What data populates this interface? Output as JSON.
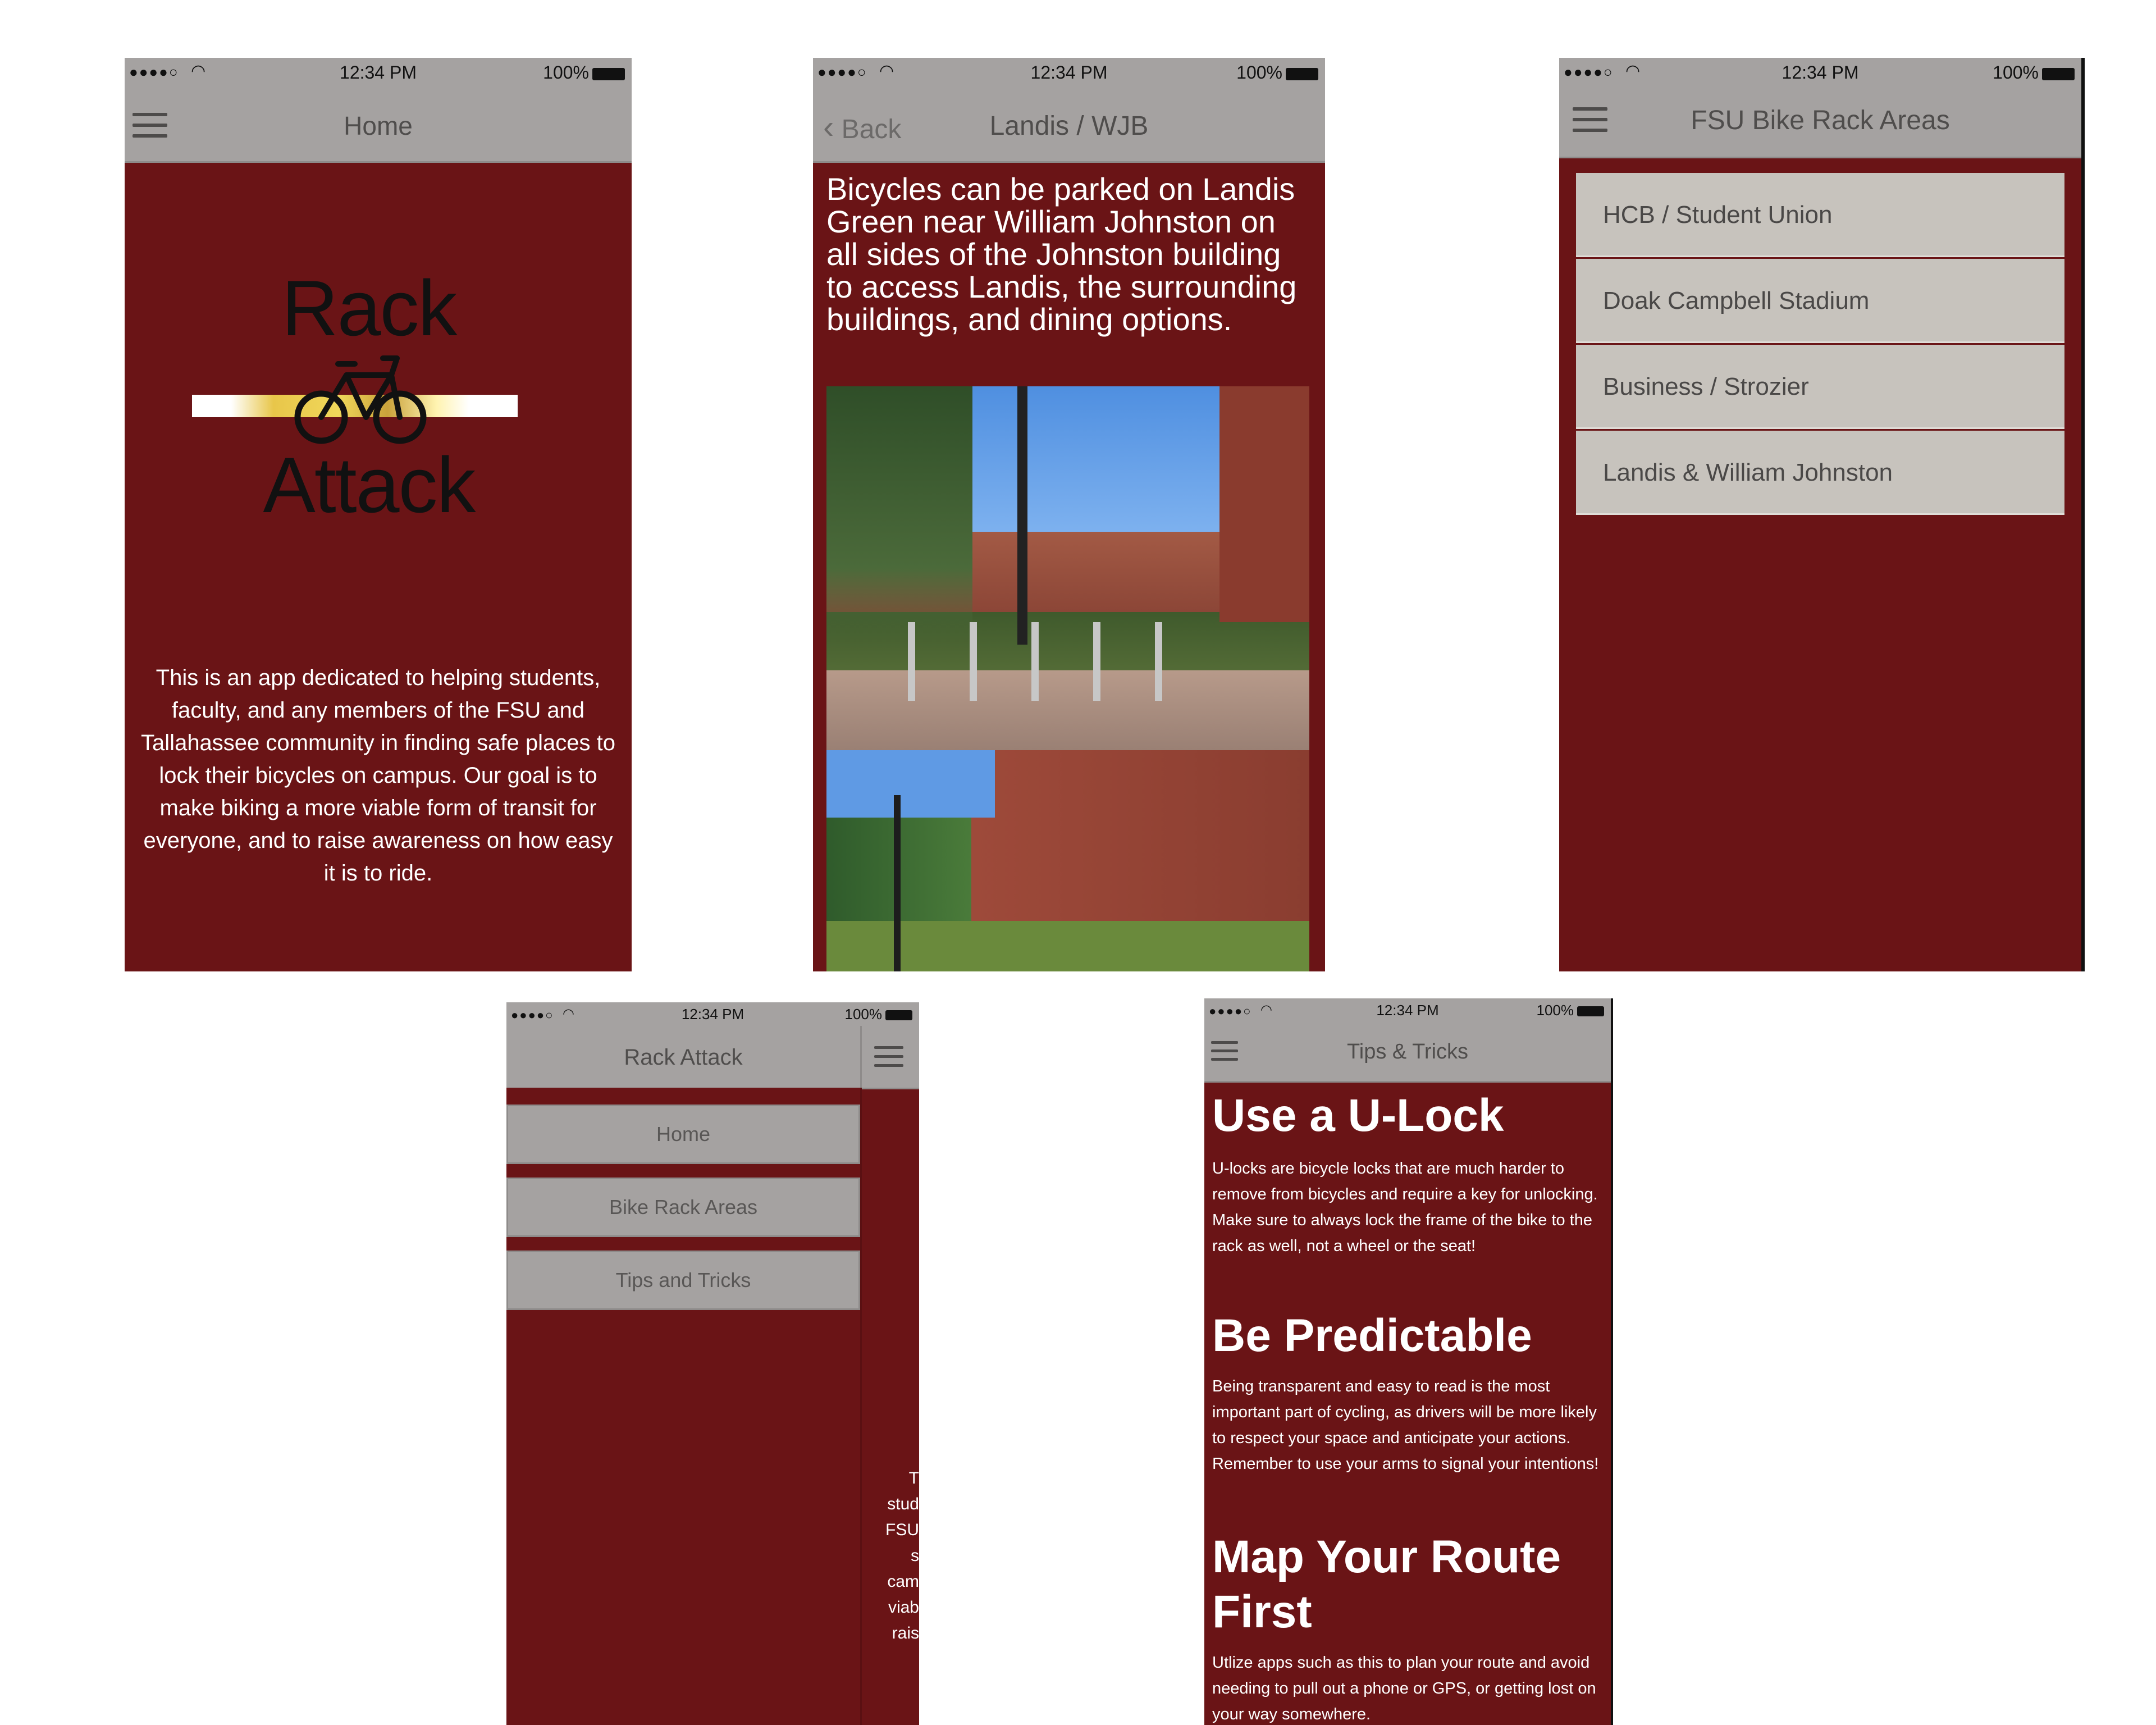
{
  "status": {
    "time": "12:34 PM",
    "battery": "100%",
    "signal": "●●●●○"
  },
  "screen1": {
    "nav_title": "Home",
    "logo_top": "Rack",
    "logo_bottom": "Attack",
    "body": "This is an app dedicated to helping students, faculty, and any members of the FSU and Tallahassee community in finding safe places to lock their bicycles on campus. Our goal is to make biking a more viable form of transit for everyone, and to raise awareness on how easy it is to ride."
  },
  "screen2": {
    "back_label": "Back",
    "nav_title": "Landis / WJB",
    "body": "Bicycles can be parked on Landis Green near William Johnston on all sides of the Johnston building to access Landis, the surrounding buildings, and dining options."
  },
  "screen3": {
    "nav_title": "FSU Bike Rack Areas",
    "items": [
      "HCB / Student Union",
      "Doak Campbell Stadium",
      "Business / Strozier",
      "Landis & William Johnston"
    ]
  },
  "screen4": {
    "nav_title": "Rack Attack",
    "menu": [
      "Home",
      "Bike Rack Areas",
      "Tips and Tricks"
    ],
    "peek_lines": [
      "T",
      "stud",
      "FSU",
      "s",
      "cam",
      "viab",
      "rais"
    ]
  },
  "screen5": {
    "nav_title": "Tips & Tricks",
    "tips": [
      {
        "heading": "Use a U-Lock",
        "text": "U-locks are bicycle locks that are much harder to remove from bicycles and require a key for unlocking. Make sure to always lock the frame of the bike to the rack as well, not a wheel or the seat!"
      },
      {
        "heading": "Be Predictable",
        "text": "Being transparent and easy to read is the most important part of cycling, as drivers will be more likely to respect your space and anticipate your actions. Remember to use your arms to signal your intentions!"
      },
      {
        "heading": "Map Your Route First",
        "text": "Utlize apps such as this to plan your route and avoid needing to pull out a phone or GPS, or getting lost on your way somewhere."
      }
    ]
  },
  "colors": {
    "maroon": "#6a1416",
    "bar_gray": "#a5a2a1",
    "list_gray": "#c7c3bd"
  }
}
